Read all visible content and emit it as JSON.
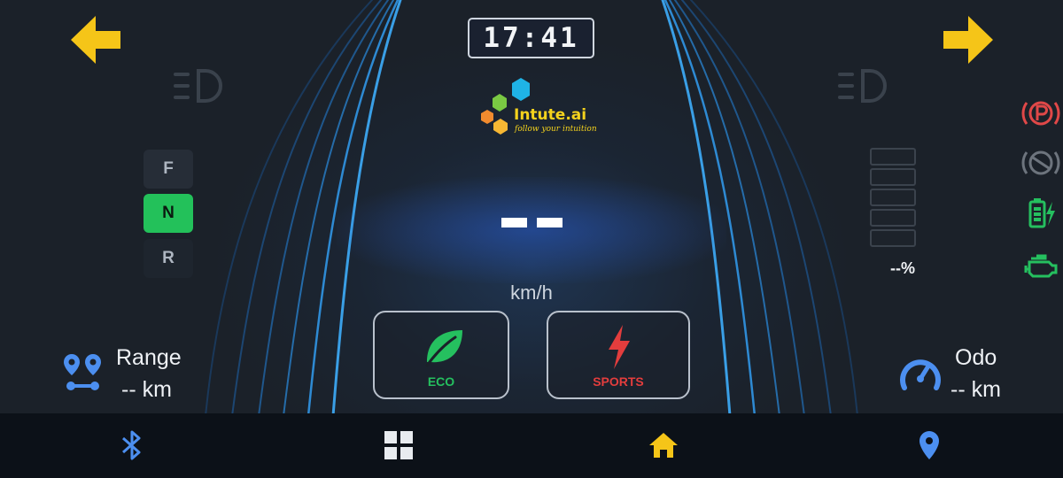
{
  "clock": {
    "time": "17:41"
  },
  "logo": {
    "name": "Intute.ai",
    "tagline": "follow your intuition"
  },
  "speed": {
    "value": "--",
    "unit": "km/h"
  },
  "gears": {
    "items": [
      "F",
      "N",
      "R"
    ],
    "selected": "N"
  },
  "modes": {
    "eco_label": "ECO",
    "sports_label": "SPORTS"
  },
  "range": {
    "title": "Range",
    "value": "-- km"
  },
  "odo": {
    "title": "Odo",
    "value": "-- km"
  },
  "battery": {
    "percent_text": "--%"
  },
  "indicators": [
    "left-turn-arrow-icon",
    "right-turn-arrow-icon",
    "headlight-left-icon",
    "headlight-right-icon",
    "parking-brake-icon",
    "brake-warning-icon",
    "battery-charging-icon",
    "engine-check-icon"
  ],
  "nav": {
    "items": [
      "bluetooth-icon",
      "apps-grid-icon",
      "home-icon",
      "location-pin-icon"
    ]
  },
  "colors": {
    "accent_yellow": "#f5c518",
    "eco_green": "#25c05f",
    "sports_red": "#e33d3d",
    "blue_icon": "#4c8ff0",
    "warning_red": "#e04848",
    "indicator_green": "#25c05f"
  }
}
